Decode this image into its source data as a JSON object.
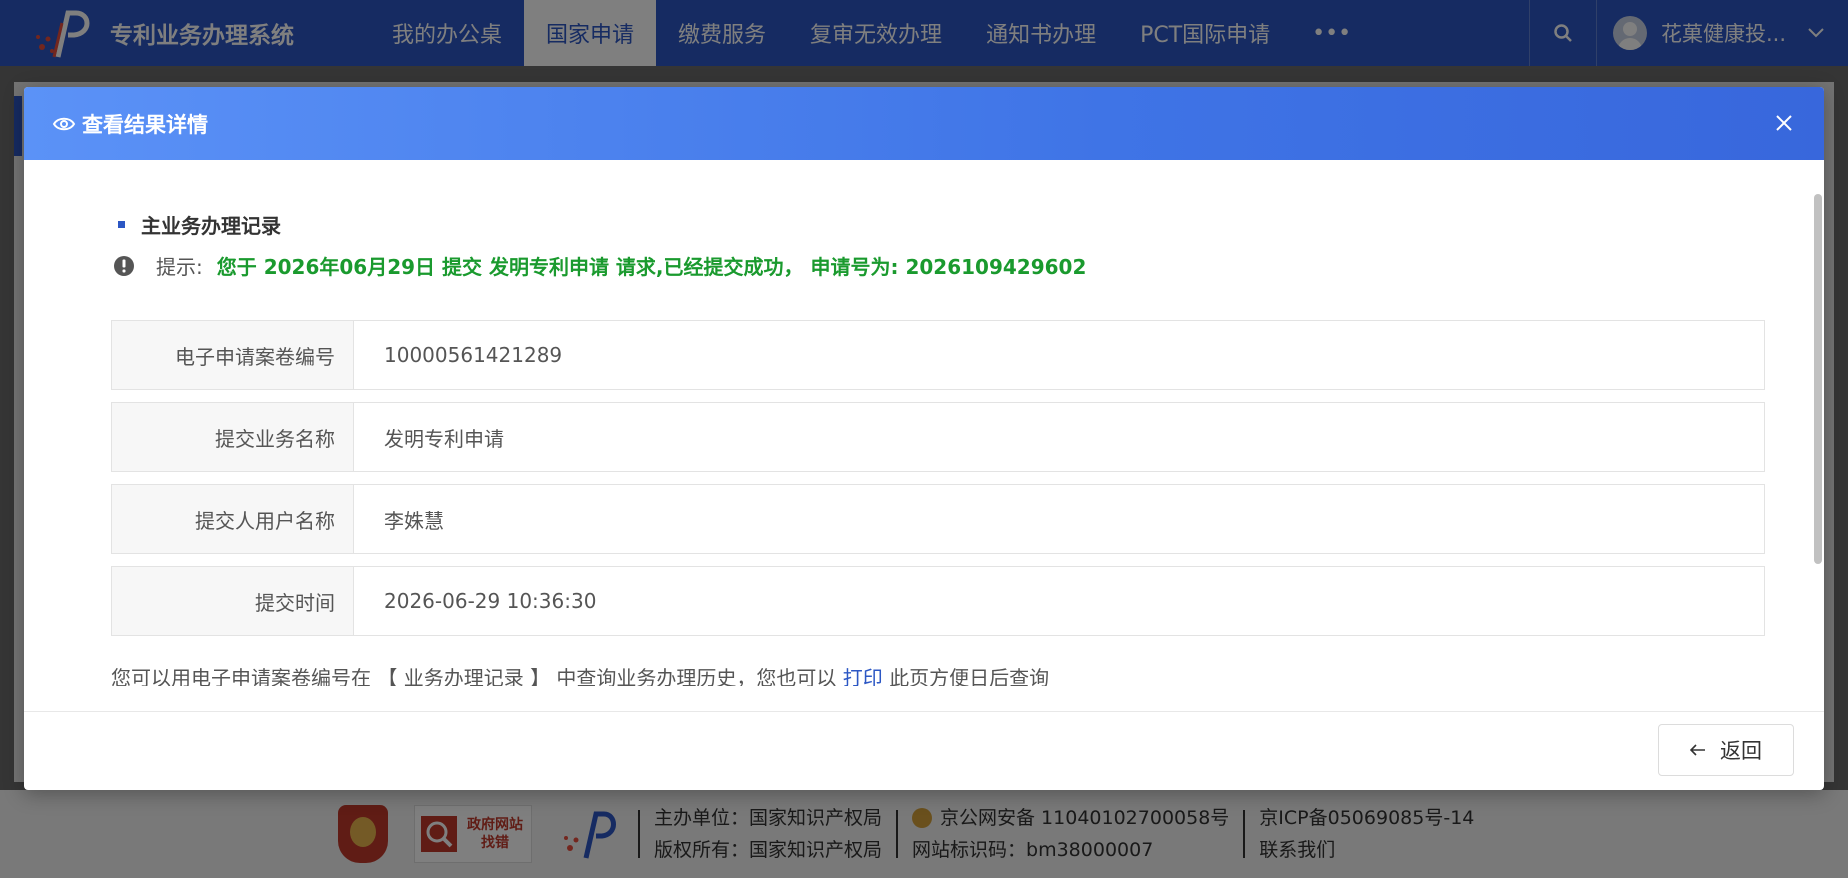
{
  "header": {
    "app_title": "专利业务办理系统",
    "nav": [
      {
        "label": "我的办公桌",
        "active": false
      },
      {
        "label": "国家申请",
        "active": true
      },
      {
        "label": "缴费服务",
        "active": false
      },
      {
        "label": "复审无效办理",
        "active": false
      },
      {
        "label": "通知书办理",
        "active": false
      },
      {
        "label": "PCT国际申请",
        "active": false
      }
    ],
    "more": "•••",
    "user_name": "花菓健康投..."
  },
  "modal": {
    "title": "查看结果详情",
    "section_title": "主业务办理记录",
    "tip_label": "提示:",
    "tip_message": "您于 2026年06月29日 提交 发明专利申请 请求,已经提交成功， 申请号为: 2026109429602",
    "rows": [
      {
        "label": "电子申请案卷编号",
        "value": "10000561421289"
      },
      {
        "label": "提交业务名称",
        "value": "发明专利申请"
      },
      {
        "label": "提交人用户名称",
        "value": "李姝慧"
      },
      {
        "label": "提交时间",
        "value": "2026-06-29 10:36:30"
      }
    ],
    "note_before": "您可以用电子申请案卷编号在 【 业务办理记录 】 中查询业务办理历史，您也可以",
    "note_link": "打印",
    "note_after": "此页方便日后查询",
    "back_label": "返回"
  },
  "footer": {
    "gov_badge_line1": "政府网站",
    "gov_badge_line2": "找错",
    "host": "主办单位：国家知识产权局",
    "copyright": "版权所有：国家知识产权局",
    "police_record": "京公网安备 11040102700058号",
    "site_code": "网站标识码：bm38000007",
    "icp": "京ICP备05069085号-14",
    "contact": "联系我们"
  },
  "colors": {
    "primary": "#2c57c4",
    "success_text": "#1a9a2e",
    "header_gradient_start": "#5b92f7",
    "header_gradient_end": "#3867dc"
  }
}
